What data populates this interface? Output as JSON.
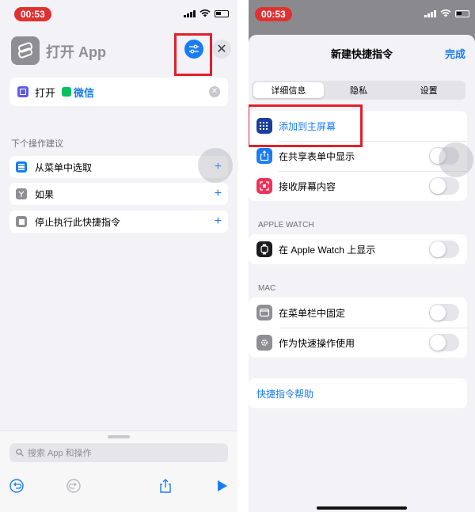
{
  "left": {
    "status_time": "00:53",
    "title": "打开 App",
    "action": {
      "verb": "打开",
      "app": "微信"
    },
    "suggestions_header": "下个操作建议",
    "suggestions": [
      {
        "label": "从菜单中选取",
        "icon": "menu-select-icon"
      },
      {
        "label": "如果",
        "icon": "if-branch-icon"
      },
      {
        "label": "停止执行此快捷指令",
        "icon": "stop-icon"
      }
    ],
    "search_placeholder": "搜索 App 和操作"
  },
  "right": {
    "status_time": "00:53",
    "sheet_title": "新建快捷指令",
    "done": "完成",
    "tabs": [
      "详细信息",
      "隐私",
      "设置"
    ],
    "active_tab": 0,
    "group1": [
      {
        "label": "添加到主屏幕",
        "icon": "home-screen-grid-icon",
        "style": "link"
      },
      {
        "label": "在共享表单中显示",
        "icon": "share-icon",
        "toggle": false
      },
      {
        "label": "接收屏幕内容",
        "icon": "screen-capture-icon",
        "toggle": false
      }
    ],
    "apple_watch_header": "APPLE WATCH",
    "apple_watch_row": {
      "label": "在 Apple Watch 上显示",
      "icon": "apple-watch-icon",
      "toggle": false
    },
    "mac_header": "MAC",
    "mac_rows": [
      {
        "label": "在菜单栏中固定",
        "icon": "menubar-icon",
        "toggle": false
      },
      {
        "label": "作为快速操作使用",
        "icon": "gear-icon",
        "toggle": false
      }
    ],
    "help_link": "快捷指令帮助"
  },
  "colors": {
    "accent": "#1a7cf5",
    "highlight": "#e0202a",
    "time_pill": "#e03131"
  }
}
